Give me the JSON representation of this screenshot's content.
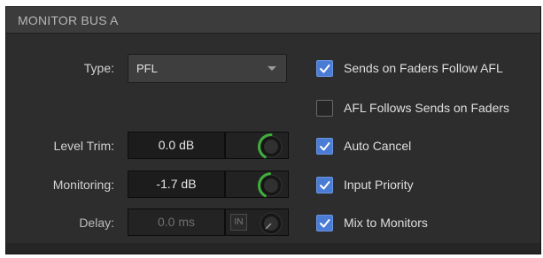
{
  "panel": {
    "title": "MONITOR BUS A"
  },
  "type_row": {
    "label": "Type:",
    "value": "PFL"
  },
  "level_trim": {
    "label": "Level Trim:",
    "value": "0.0 dB",
    "knob_level": 0.5
  },
  "monitoring": {
    "label": "Monitoring:",
    "value": "-1.7 dB",
    "knob_level": 0.48
  },
  "delay": {
    "label": "Delay:",
    "value": "0.0 ms",
    "in_label": "IN",
    "knob_level": 0.0
  },
  "options": [
    {
      "label": "Sends on Faders Follow AFL",
      "checked": true
    },
    {
      "label": "AFL Follows Sends on Faders",
      "checked": false
    },
    {
      "label": "Auto Cancel",
      "checked": true
    },
    {
      "label": "Input Priority",
      "checked": true
    },
    {
      "label": "Mix to Monitors",
      "checked": true
    }
  ],
  "colors": {
    "checked": "#4a7cd6",
    "knob_arc": "#3fae3a"
  }
}
